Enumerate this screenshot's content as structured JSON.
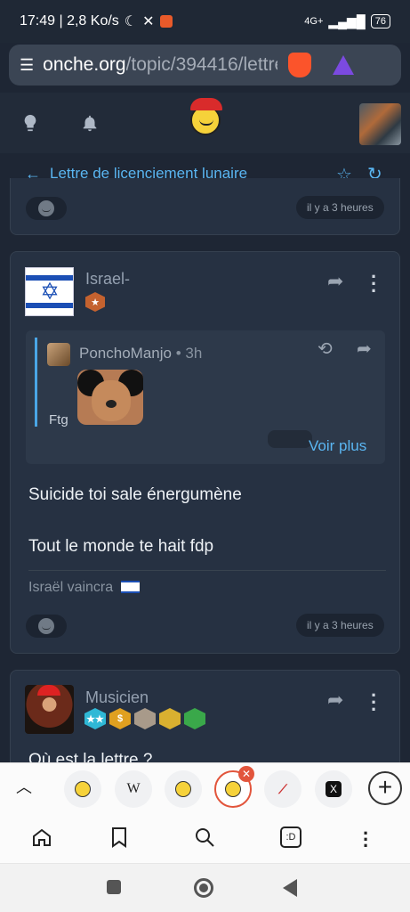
{
  "status_bar": {
    "time_speed": "17:49 | 2,8 Ko/s",
    "network": "4G+",
    "battery": "76"
  },
  "browser": {
    "url_host": "onche.org",
    "url_path": "/topic/394416/lettre-"
  },
  "topic": {
    "title": "Lettre de licenciement lunaire"
  },
  "posts": [
    {
      "time": "il y a 3 heures"
    },
    {
      "username": "Israel-",
      "quote": {
        "username": "PonchoManjo",
        "time": "3h",
        "text": "Ftg",
        "voir_plus": "Voir plus"
      },
      "body_lines": [
        "Suicide toi sale énergumène",
        "Tout le monde te hait fdp"
      ],
      "signature": "Israël vaincra",
      "time": "il y a 3 heures"
    },
    {
      "username": "Musicien",
      "body_lines": [
        "Où est la lettre ?"
      ]
    }
  ],
  "tabs": {
    "wiki_label": "W",
    "close": "✕",
    "new_tab": "+"
  },
  "toolbar": {
    "extension_label": ":D"
  },
  "colors": {
    "accent": "#5ab6f2",
    "background": "#1e2634",
    "card": "#263142"
  }
}
